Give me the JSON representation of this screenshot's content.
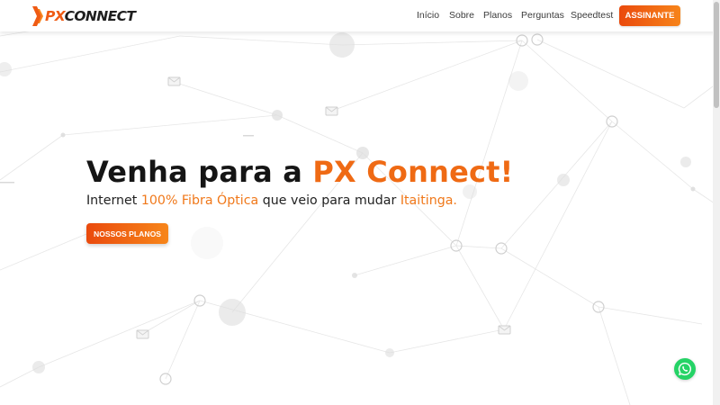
{
  "brand": {
    "name_prefix": "PX",
    "name_suffix": "CONNECT",
    "accent_color": "#ef5b14"
  },
  "nav": {
    "items": [
      {
        "label": "Início"
      },
      {
        "label": "Sobre"
      },
      {
        "label": "Planos"
      },
      {
        "label": "Perguntas"
      },
      {
        "label": "Speedtest"
      }
    ],
    "cta_label": "ASSINANTE"
  },
  "hero": {
    "title_lead": "Venha para a ",
    "title_highlight": "PX Connect!",
    "subtitle_part1": "Internet ",
    "subtitle_highlight1": "100% Fibra Óptica",
    "subtitle_part2": " que veio para mudar ",
    "subtitle_highlight2": "Itaitinga.",
    "button_label": "NOSSOS PLANOS"
  },
  "floating": {
    "icon": "whatsapp-icon",
    "color": "#25d366"
  },
  "colors": {
    "accent": "#ef6a14",
    "button_start": "#ea4a0d",
    "button_end": "#f7841a"
  }
}
